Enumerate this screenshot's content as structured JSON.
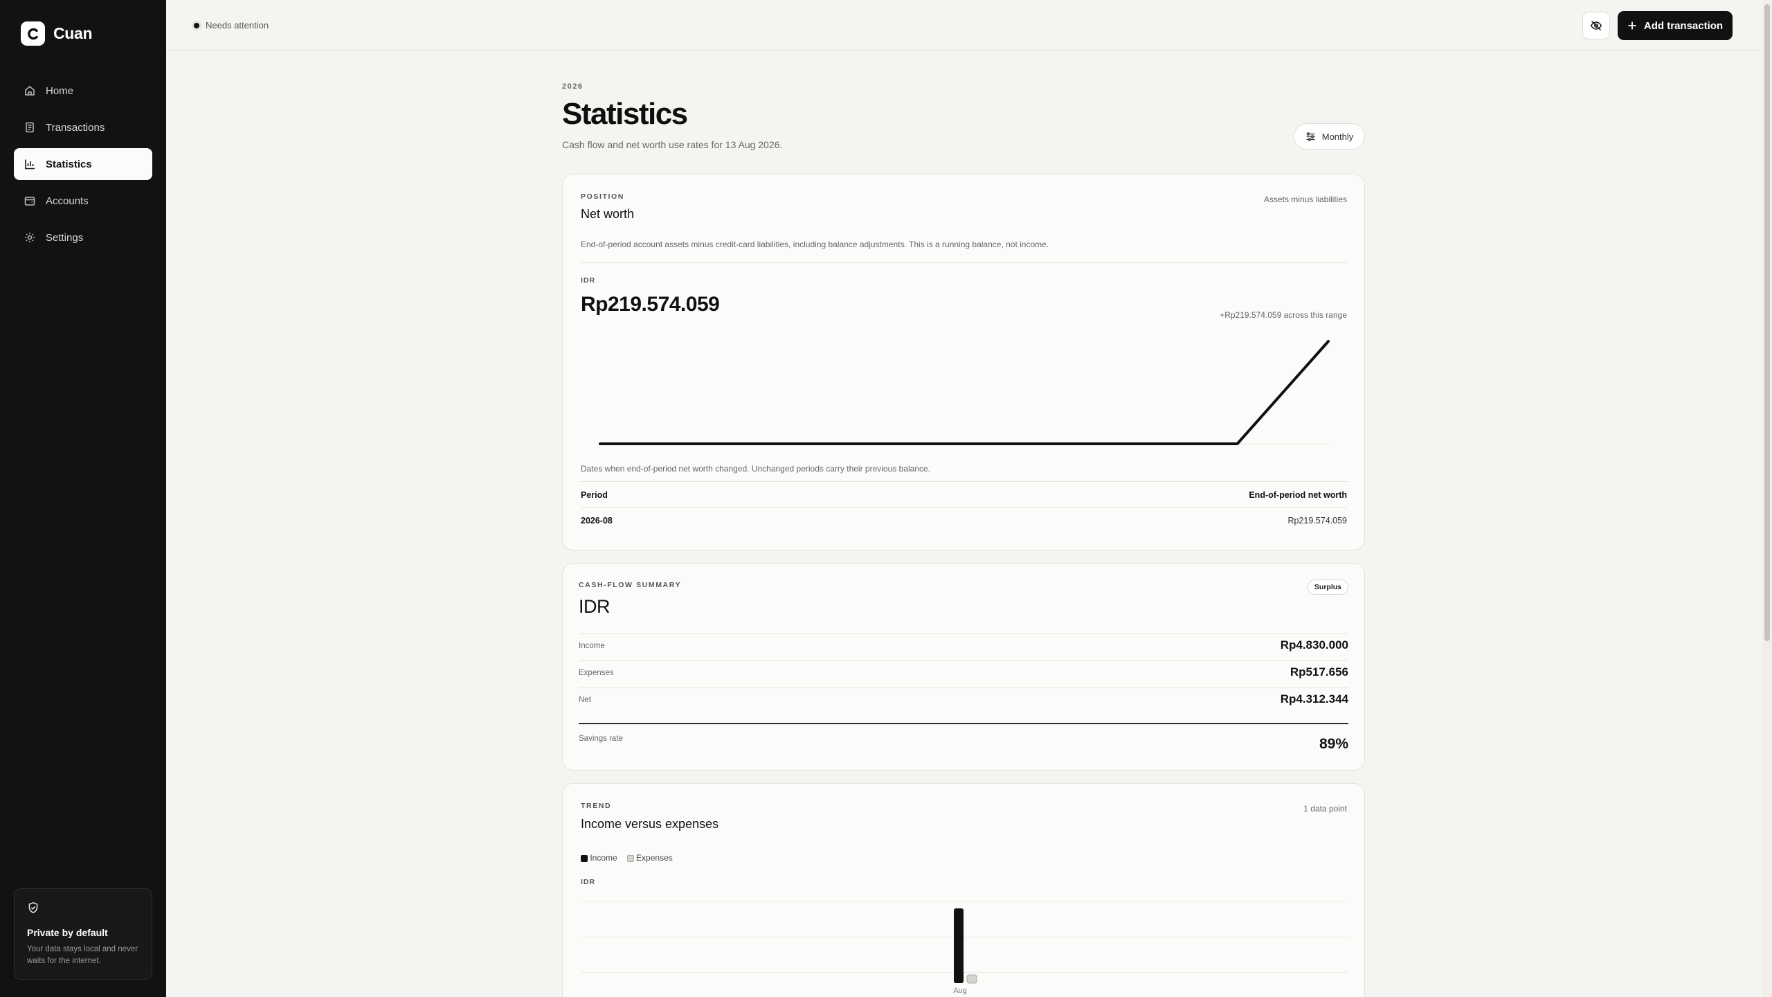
{
  "app": {
    "name": "Cuan"
  },
  "sidebar": {
    "items": [
      {
        "label": "Home",
        "icon": "home-icon",
        "active": false
      },
      {
        "label": "Transactions",
        "icon": "receipt-icon",
        "active": false
      },
      {
        "label": "Statistics",
        "icon": "bar-chart-icon",
        "active": true
      },
      {
        "label": "Accounts",
        "icon": "wallet-icon",
        "active": false
      },
      {
        "label": "Settings",
        "icon": "gear-icon",
        "active": false
      }
    ],
    "privacy": {
      "title": "Private by default",
      "text": "Your data stays local and never waits for the internet."
    }
  },
  "topbar": {
    "status": "Needs attention",
    "hide_icon": "eye-off-icon",
    "add_label": "Add transaction"
  },
  "header": {
    "year": "2026",
    "title": "Statistics",
    "subtitle": "Cash flow and net worth use rates for 13 Aug 2026.",
    "period": "Monthly"
  },
  "net_worth": {
    "eyebrow": "POSITION",
    "title": "Net worth",
    "tag": "Assets minus liabilities",
    "description": "End-of-period account assets minus credit-card liabilities, including balance adjustments. This is a running balance, not income.",
    "currency": "IDR",
    "value": "Rp219.574.059",
    "change": "+Rp219.574.059 across this range",
    "note": "Dates when end-of-period net worth changed. Unchanged periods carry their previous balance.",
    "table_headers": [
      "Period",
      "End-of-period net worth"
    ],
    "table_rows": [
      {
        "period": "2026-08",
        "value": "Rp219.574.059"
      }
    ]
  },
  "cash_flow": {
    "eyebrow": "CASH-FLOW SUMMARY",
    "title": "IDR",
    "badge": "Surplus",
    "rows": [
      {
        "label": "Income",
        "value": "Rp4.830.000"
      },
      {
        "label": "Expenses",
        "value": "Rp517.656"
      },
      {
        "label": "Net",
        "value": "Rp4.312.344"
      }
    ],
    "savings_label": "Savings rate",
    "savings_value": "89%"
  },
  "trend": {
    "eyebrow": "TREND",
    "title": "Income versus expenses",
    "count": "1 data point",
    "legend": [
      "Income",
      "Expenses"
    ],
    "axis_label": "IDR"
  },
  "chart_data": [
    {
      "type": "line",
      "title": "",
      "x": [
        0,
        1,
        2,
        3,
        4,
        5,
        6,
        7,
        8
      ],
      "values": [
        0,
        0,
        0,
        0,
        0,
        0,
        0,
        0,
        219574059
      ],
      "xlabel": "",
      "ylabel": "",
      "grid": false
    },
    {
      "type": "bar",
      "categories": [
        "Aug"
      ],
      "series": [
        {
          "name": "Income",
          "values": [
            4830000
          ],
          "color": "#111111"
        },
        {
          "name": "Expenses",
          "values": [
            517656
          ],
          "color": "#d4d4d0"
        }
      ],
      "ylabel": "IDR",
      "grid": true
    }
  ]
}
